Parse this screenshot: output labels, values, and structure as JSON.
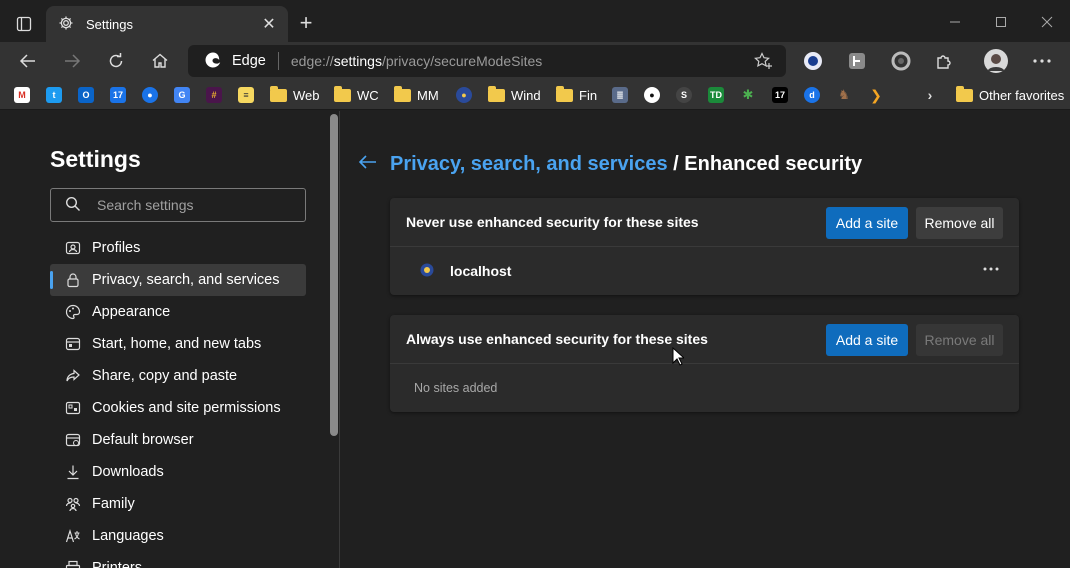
{
  "window": {
    "tab_title": "Settings"
  },
  "toolbar": {
    "edge_label": "Edge",
    "url_prefix": "edge://",
    "url_host": "settings",
    "url_path": "/privacy/secureModeSites"
  },
  "favorites": [
    {
      "label": "Web",
      "type": "folder"
    },
    {
      "label": "WC",
      "type": "folder"
    },
    {
      "label": "MM",
      "type": "folder"
    },
    {
      "label": "Wind",
      "type": "folder"
    },
    {
      "label": "Fin",
      "type": "folder"
    },
    {
      "label": "Other favorites",
      "type": "folder"
    }
  ],
  "sidebar": {
    "title": "Settings",
    "search_placeholder": "Search settings",
    "items": [
      {
        "label": "Profiles",
        "icon": "profile-icon"
      },
      {
        "label": "Privacy, search, and services",
        "icon": "lock-icon",
        "active": true
      },
      {
        "label": "Appearance",
        "icon": "palette-icon"
      },
      {
        "label": "Start, home, and new tabs",
        "icon": "home-tabs-icon"
      },
      {
        "label": "Share, copy and paste",
        "icon": "share-icon"
      },
      {
        "label": "Cookies and site permissions",
        "icon": "cookies-icon"
      },
      {
        "label": "Default browser",
        "icon": "browser-icon"
      },
      {
        "label": "Downloads",
        "icon": "download-icon"
      },
      {
        "label": "Family",
        "icon": "family-icon"
      },
      {
        "label": "Languages",
        "icon": "language-icon"
      },
      {
        "label": "Printers",
        "icon": "printer-icon"
      }
    ]
  },
  "main": {
    "breadcrumb_parent": "Privacy, search, and services",
    "breadcrumb_sep": " / ",
    "breadcrumb_current": "Enhanced security",
    "never_card": {
      "title": "Never use enhanced security for these sites",
      "add_label": "Add a site",
      "remove_label": "Remove all",
      "sites": [
        "localhost"
      ]
    },
    "always_card": {
      "title": "Always use enhanced security for these sites",
      "add_label": "Add a site",
      "remove_label": "Remove all",
      "empty_text": "No sites added"
    }
  },
  "colors": {
    "accent": "#4aa3f0",
    "primary_button": "#0f6cbd",
    "background": "#202020",
    "card": "#2b2b2b"
  }
}
